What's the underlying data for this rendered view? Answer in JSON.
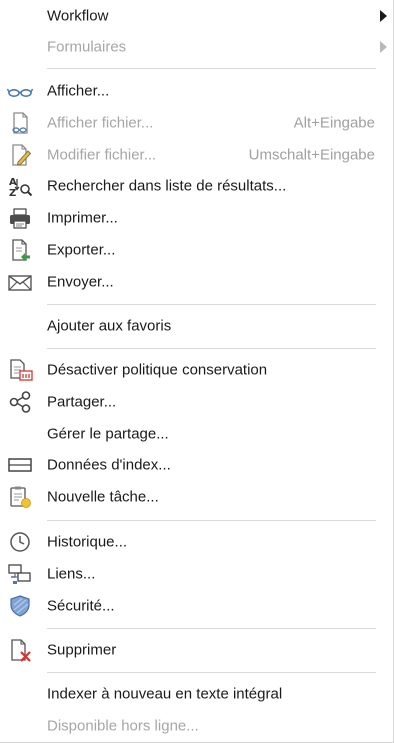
{
  "menu": {
    "workflow": "Workflow",
    "formulaires": "Formulaires",
    "afficher": "Afficher...",
    "afficher_fichier": "Afficher fichier...",
    "afficher_fichier_shortcut": "Alt+Eingabe",
    "modifier_fichier": "Modifier fichier...",
    "modifier_fichier_shortcut": "Umschalt+Eingabe",
    "rechercher": "Rechercher dans liste de résultats...",
    "imprimer": "Imprimer...",
    "exporter": "Exporter...",
    "envoyer": "Envoyer...",
    "favoris": "Ajouter aux favoris",
    "desactiver": "Désactiver politique conservation",
    "partager": "Partager...",
    "gerer_partage": "Gérer le partage...",
    "donnees_index": "Données d'index...",
    "nouvelle_tache": "Nouvelle tâche...",
    "historique": "Historique...",
    "liens": "Liens...",
    "securite": "Sécurité...",
    "supprimer": "Supprimer",
    "indexer": "Indexer à nouveau en texte intégral",
    "disponible": "Disponible hors ligne..."
  },
  "icons": {
    "afficher": "glasses-icon",
    "afficher_fichier": "document-view-icon",
    "modifier_fichier": "document-edit-icon",
    "rechercher": "az-search-icon",
    "imprimer": "printer-icon",
    "exporter": "document-export-icon",
    "envoyer": "envelope-icon",
    "desactiver": "retention-policy-icon",
    "partager": "share-icon",
    "donnees_index": "index-data-icon",
    "nouvelle_tache": "task-icon",
    "historique": "clock-icon",
    "liens": "links-icon",
    "securite": "shield-icon",
    "supprimer": "document-delete-icon"
  },
  "colors": {
    "text": "#1a1a1a",
    "disabled_text": "#a6a6a6",
    "separator": "#d9d9d9",
    "icon_blue": "#4a78b5",
    "icon_red": "#d8332f",
    "icon_yellow": "#f2c230"
  }
}
